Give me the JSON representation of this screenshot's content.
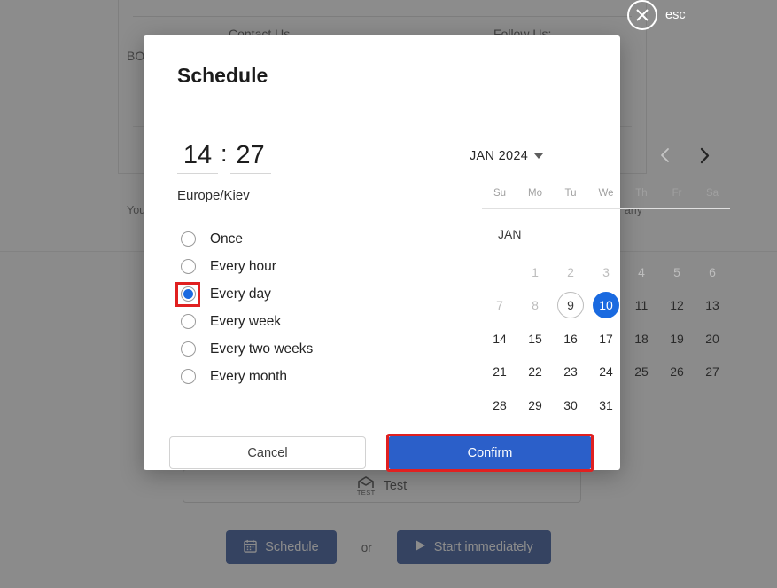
{
  "overlay": {
    "close_label": "esc",
    "close_icon": "close-circle-icon"
  },
  "background_page": {
    "contact_heading": "Contact Us",
    "follow_heading": "Follow Us:",
    "brand_fragment": "BO",
    "legal_left_fragment": "You",
    "legal_right_fragment": "any",
    "test_button": {
      "label": "Test",
      "icon_word": "TEST",
      "icon": "test-envelope-icon"
    },
    "actions": {
      "schedule_label": "Schedule",
      "schedule_icon": "calendar-icon",
      "separator": "or",
      "start_label": "Start immediately",
      "start_icon": "play-icon"
    }
  },
  "modal": {
    "title": "Schedule",
    "time": {
      "hours": "14",
      "minutes": "27",
      "separator": ":",
      "timezone": "Europe/Kiev"
    },
    "repeat_options": [
      {
        "label": "Once",
        "selected": false
      },
      {
        "label": "Every hour",
        "selected": false
      },
      {
        "label": "Every day",
        "selected": true
      },
      {
        "label": "Every week",
        "selected": false
      },
      {
        "label": "Every two weeks",
        "selected": false
      },
      {
        "label": "Every month",
        "selected": false
      }
    ],
    "calendar": {
      "month_year": "JAN 2024",
      "month_short": "JAN",
      "prev_icon": "chevron-left-icon",
      "next_icon": "chevron-right-icon",
      "prev_enabled": false,
      "next_enabled": true,
      "dropdown_icon": "caret-down-icon",
      "weekdays": [
        "Su",
        "Mo",
        "Tu",
        "We",
        "Th",
        "Fr",
        "Sa"
      ],
      "leading_blanks": 1,
      "days": [
        {
          "n": "1",
          "state": "disabled"
        },
        {
          "n": "2",
          "state": "disabled"
        },
        {
          "n": "3",
          "state": "disabled"
        },
        {
          "n": "4",
          "state": "disabled"
        },
        {
          "n": "5",
          "state": "disabled"
        },
        {
          "n": "6",
          "state": "disabled"
        },
        {
          "n": "7",
          "state": "disabled"
        },
        {
          "n": "8",
          "state": "disabled"
        },
        {
          "n": "9",
          "state": "today"
        },
        {
          "n": "10",
          "state": "selected"
        },
        {
          "n": "11",
          "state": "normal"
        },
        {
          "n": "12",
          "state": "normal"
        },
        {
          "n": "13",
          "state": "normal"
        },
        {
          "n": "14",
          "state": "normal"
        },
        {
          "n": "15",
          "state": "normal"
        },
        {
          "n": "16",
          "state": "normal"
        },
        {
          "n": "17",
          "state": "normal"
        },
        {
          "n": "18",
          "state": "normal"
        },
        {
          "n": "19",
          "state": "normal"
        },
        {
          "n": "20",
          "state": "normal"
        },
        {
          "n": "21",
          "state": "normal"
        },
        {
          "n": "22",
          "state": "normal"
        },
        {
          "n": "23",
          "state": "normal"
        },
        {
          "n": "24",
          "state": "normal"
        },
        {
          "n": "25",
          "state": "normal"
        },
        {
          "n": "26",
          "state": "normal"
        },
        {
          "n": "27",
          "state": "normal"
        },
        {
          "n": "28",
          "state": "normal"
        },
        {
          "n": "29",
          "state": "normal"
        },
        {
          "n": "30",
          "state": "normal"
        },
        {
          "n": "31",
          "state": "normal"
        }
      ]
    },
    "footer": {
      "cancel_label": "Cancel",
      "confirm_label": "Confirm"
    }
  },
  "colors": {
    "accent_blue": "#1a6ae0",
    "confirm_blue": "#2b5fc9",
    "highlight_red": "#e02020",
    "page_button_navy": "#1b3f8f"
  }
}
